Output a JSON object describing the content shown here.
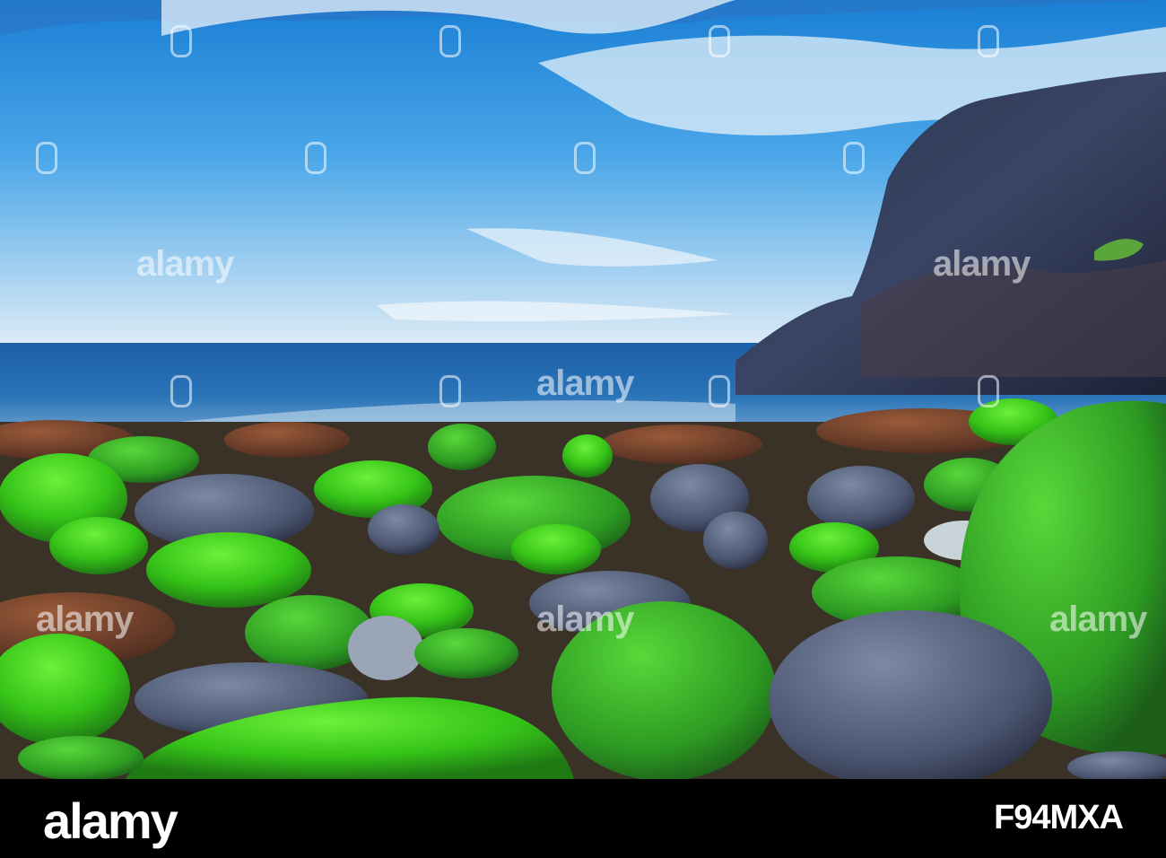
{
  "watermark": {
    "text": "alamy"
  },
  "footer": {
    "brand": "alamy",
    "image_id": "F94MXA"
  },
  "colors": {
    "sky_top": "#1e88d8",
    "sea": "#1b5aa6",
    "moss": "#3fd21c",
    "footer_bg": "#000000"
  }
}
